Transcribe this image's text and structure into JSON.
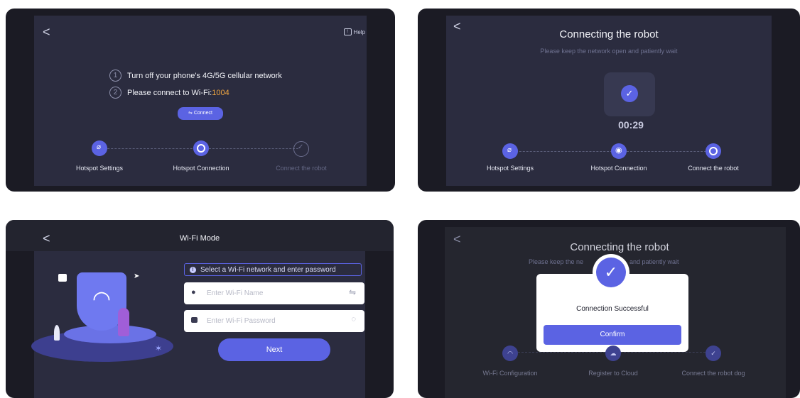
{
  "panel1": {
    "back": "<",
    "help_label": "Help",
    "instruction1_num": "1",
    "instruction1": "Turn off your phone's 4G/5G cellular network",
    "instruction2_num": "2",
    "instruction2_prefix": "Please connect to Wi-Fi:",
    "wifi_name": "1004",
    "connect_button": "⇋ Connect",
    "steps": [
      "Hotspot Settings",
      "Hotspot Connection",
      "Connect the robot"
    ]
  },
  "panel2": {
    "back": "<",
    "title": "Connecting the robot",
    "subtitle": "Please keep the network open and patiently wait",
    "timer": "00:29",
    "steps": [
      "Hotspot Settings",
      "Hotspot Connection",
      "Connect the robot"
    ]
  },
  "panel3": {
    "back": "<",
    "title": "Wi-Fi Mode",
    "notice": "Select a Wi-Fi network and enter password",
    "name_placeholder": "Enter Wi-Fi Name",
    "password_placeholder": "Enter Wi-Fi Password",
    "next_button": "Next"
  },
  "panel4": {
    "back": "<",
    "title": "Connecting the robot",
    "subtitle_left": "Please keep the ne",
    "subtitle_right": "and patiently wait",
    "modal_message": "Connection Successful",
    "confirm_button": "Confirm",
    "steps": [
      "Wi-Fi Configuration",
      "Register to Cloud",
      "Connect the robot dog"
    ]
  },
  "colors": {
    "accent": "#5b63e3",
    "wifi_name": "#f0a640",
    "panel_bg": "#2b2c3f"
  }
}
